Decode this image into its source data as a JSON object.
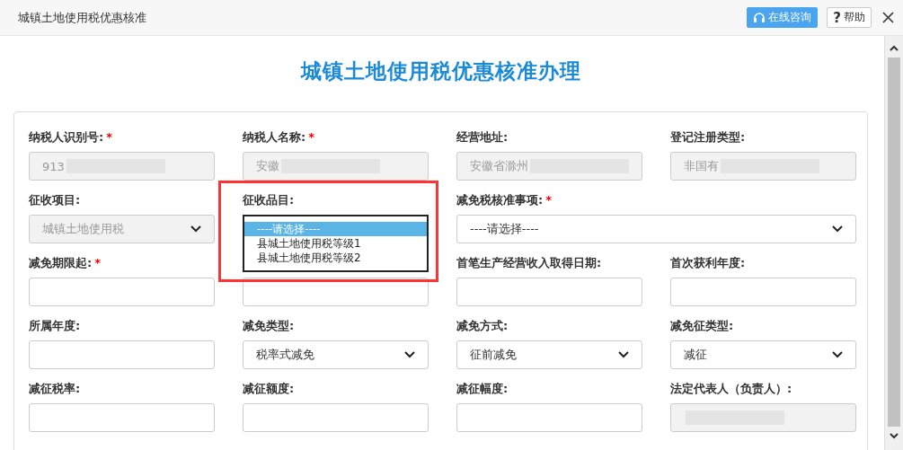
{
  "window": {
    "title": "城镇土地使用税优惠核准"
  },
  "header_buttons": [
    {
      "kind": "consult",
      "label": "在线咨询"
    },
    {
      "kind": "help",
      "glyph": "?",
      "label": "帮助"
    }
  ],
  "heading": "城镇土地使用税优惠核准办理",
  "form_rows": [
    [
      {
        "kind": "text",
        "label": "纳税人识别号:",
        "required_mark": "*",
        "disabled": true,
        "value": "913",
        "redacted": true
      },
      {
        "kind": "text",
        "label": "纳税人名称:",
        "required_mark": "*",
        "disabled": true,
        "value": "安徽",
        "redacted": true
      },
      {
        "kind": "text",
        "label": "经营地址:",
        "disabled": true,
        "value": "安徽省滁州",
        "redacted": true
      },
      {
        "kind": "text",
        "label": "登记注册类型:",
        "disabled": true,
        "value": "非国有",
        "redacted": true
      }
    ],
    [
      {
        "kind": "select",
        "label": "征收项目:",
        "disabled": true,
        "value": "城镇土地使用税"
      },
      {
        "kind": "listbox",
        "label": "征收品目:",
        "highlighted": true,
        "options": [
          {
            "label": "----请选择----",
            "selected": true
          },
          {
            "label": "县城土地使用税等级1",
            "selected": false
          },
          {
            "label": "县城土地使用税等级2",
            "selected": false
          }
        ]
      },
      {
        "kind": "select",
        "label": "减免税核准事项:",
        "required_mark": "*",
        "value": "----请选择----",
        "wide": true
      }
    ],
    [
      {
        "kind": "text",
        "label": "减免期限起:",
        "required_mark": "*"
      },
      {
        "kind": "text"
      },
      {
        "kind": "text",
        "label": "首笔生产经营收入取得日期:"
      },
      {
        "kind": "text",
        "label": "首次获利年度:"
      }
    ],
    [
      {
        "kind": "text",
        "label": "所属年度:"
      },
      {
        "kind": "select",
        "label": "减免类型:",
        "value": "税率式减免"
      },
      {
        "kind": "select",
        "label": "减免方式:",
        "value": "征前减免"
      },
      {
        "kind": "select",
        "label": "减免征类型:",
        "value": "减征"
      }
    ],
    [
      {
        "kind": "text",
        "label": "减征税率:"
      },
      {
        "kind": "text",
        "label": "减征额度:"
      },
      {
        "kind": "text",
        "label": "减征幅度:"
      },
      {
        "kind": "text",
        "label": "法定代表人（负责人）:",
        "disabled": true,
        "redacted": true
      }
    ]
  ]
}
